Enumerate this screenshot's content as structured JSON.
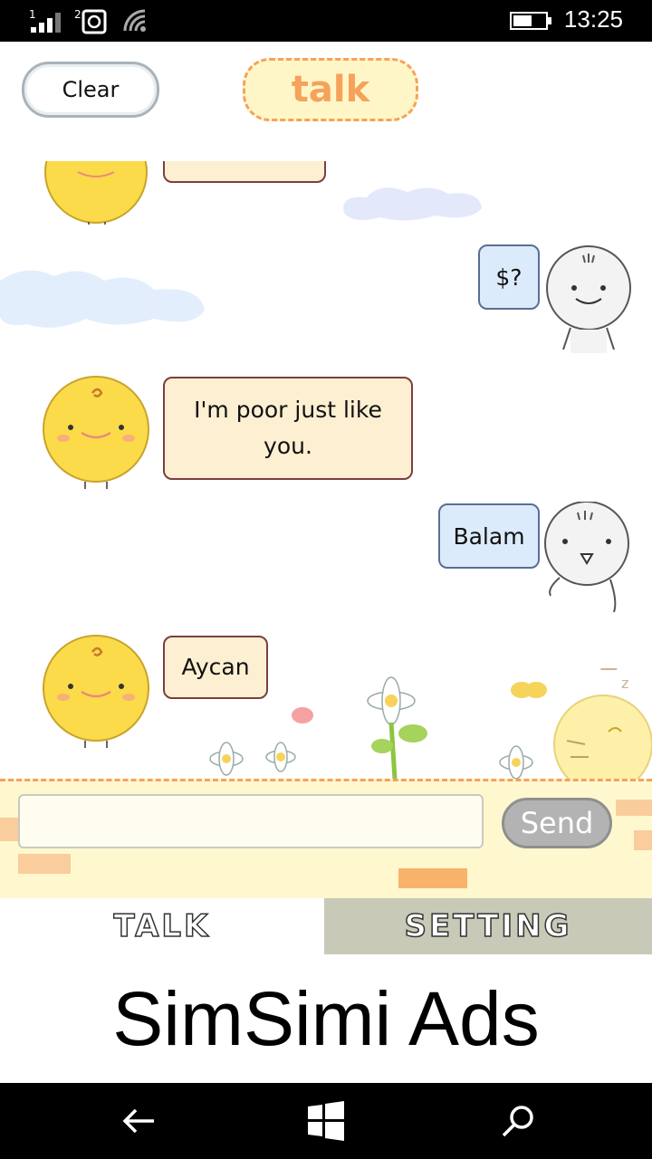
{
  "status": {
    "time": "13:25",
    "sim1_label": "1",
    "sim2_label": "2"
  },
  "header": {
    "clear_label": "Clear",
    "title": "talk"
  },
  "messages": [
    {
      "from": "simsimi",
      "text": "I'm poor just like you."
    },
    {
      "from": "user",
      "text": "$?"
    },
    {
      "from": "user",
      "text": "Balam"
    },
    {
      "from": "simsimi",
      "text": "Aycan"
    }
  ],
  "input": {
    "value": "",
    "placeholder": "",
    "send_label": "Send"
  },
  "tabs": {
    "talk_label": "TALK",
    "setting_label": "SETTING"
  },
  "ads": {
    "text": "SimSimi Ads"
  },
  "colors": {
    "accent_orange": "#f5a25c",
    "sim_bubble": "#fdf0d2",
    "user_bubble": "#dcebfb",
    "input_bg": "#fff8cf"
  }
}
